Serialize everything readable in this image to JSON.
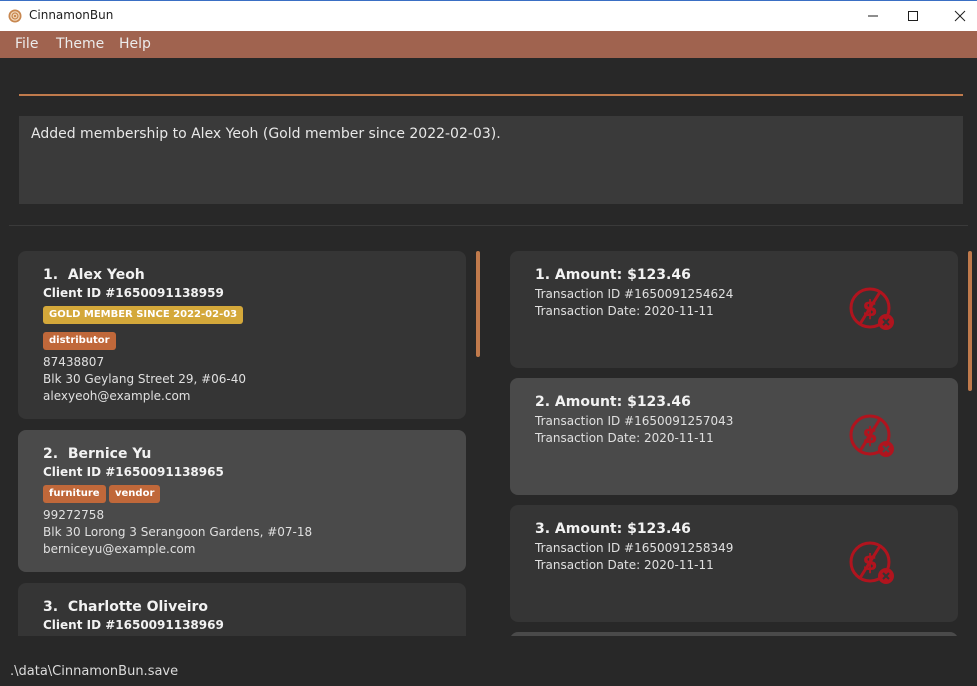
{
  "window": {
    "title": "CinnamonBun",
    "icons": {
      "app": "cinnamon-bun-icon",
      "minimize": "minimize-icon",
      "maximize": "maximize-icon",
      "close": "close-icon"
    }
  },
  "menu": [
    "File",
    "Theme",
    "Help"
  ],
  "command": {
    "value": "",
    "placeholder": ""
  },
  "result": "Added membership to Alex Yeoh (Gold member since 2022-02-03).",
  "clients": [
    {
      "index": "1.",
      "name": "Alex Yeoh",
      "client_id": "Client ID #1650091138959",
      "membership": "GOLD MEMBER SINCE 2022-02-03",
      "tags": [
        "distributor"
      ],
      "phone": "87438807",
      "address": "Blk 30 Geylang Street 29, #06-40",
      "email": "alexyeoh@example.com"
    },
    {
      "index": "2.",
      "name": "Bernice Yu",
      "client_id": "Client ID #1650091138965",
      "tags": [
        "furniture",
        "vendor"
      ],
      "phone": "99272758",
      "address": "Blk 30 Lorong 3 Serangoon Gardens, #07-18",
      "email": "berniceyu@example.com"
    },
    {
      "index": "3.",
      "name": "Charlotte Oliveiro",
      "client_id": "Client ID #1650091138969"
    }
  ],
  "transactions": [
    {
      "title": "1. Amount: $123.46",
      "transaction_id": "Transaction ID #1650091254624",
      "date": "Transaction Date: 2020-11-11",
      "icon": "unpaid-dollar-icon"
    },
    {
      "title": "2. Amount: $123.46",
      "transaction_id": "Transaction ID #1650091257043",
      "date": "Transaction Date: 2020-11-11",
      "icon": "unpaid-dollar-icon"
    },
    {
      "title": "3. Amount: $123.46",
      "transaction_id": "Transaction ID #1650091258349",
      "date": "Transaction Date: 2020-11-11",
      "icon": "unpaid-dollar-icon"
    }
  ],
  "status_bar": ".\\data\\CinnamonBun.save",
  "colors": {
    "accent": "#c07a4c",
    "menu_bar": "#a0634f",
    "gold_tag": "#d4a83a",
    "category_tag": "#c0683a",
    "unpaid_icon": "#b0141e"
  }
}
